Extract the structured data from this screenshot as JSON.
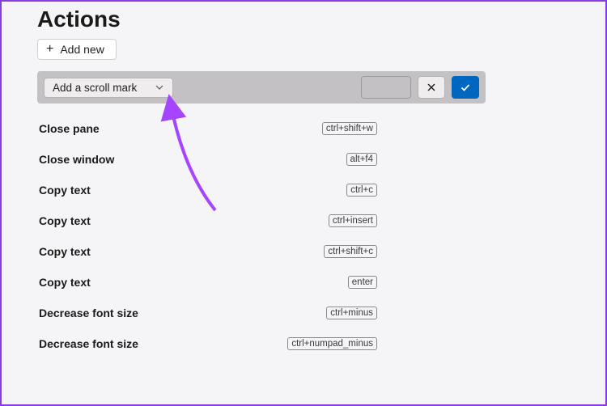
{
  "title": "Actions",
  "addNew": {
    "label": "Add new"
  },
  "editRow": {
    "dropdown": "Add a scroll mark"
  },
  "rows": [
    {
      "label": "Close pane",
      "key": "ctrl+shift+w"
    },
    {
      "label": "Close window",
      "key": "alt+f4"
    },
    {
      "label": "Copy text",
      "key": "ctrl+c"
    },
    {
      "label": "Copy text",
      "key": "ctrl+insert"
    },
    {
      "label": "Copy text",
      "key": "ctrl+shift+c"
    },
    {
      "label": "Copy text",
      "key": "enter"
    },
    {
      "label": "Decrease font size",
      "key": "ctrl+minus"
    },
    {
      "label": "Decrease font size",
      "key": "ctrl+numpad_minus"
    }
  ],
  "annotation": {
    "color": "#a645ff"
  }
}
